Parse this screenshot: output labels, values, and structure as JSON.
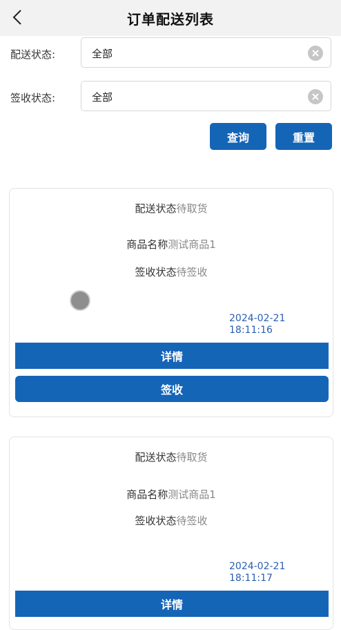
{
  "header": {
    "title": "订单配送列表"
  },
  "filters": [
    {
      "label": "配送状态:",
      "value": "全部"
    },
    {
      "label": "签收状态:",
      "value": "全部"
    }
  ],
  "actions": {
    "query_label": "查询",
    "reset_label": "重置"
  },
  "orders": [
    {
      "delivery_status_label": "配送状态",
      "delivery_status": "待取货",
      "product_label": "商品名称",
      "product_name": "测试商品1",
      "sign_status_label": "签收状态",
      "sign_status": "待签收",
      "date": "2024-02-21",
      "time": "18:11:16",
      "detail_label": "详情",
      "sign_label": "签收"
    },
    {
      "delivery_status_label": "配送状态",
      "delivery_status": "待取货",
      "product_label": "商品名称",
      "product_name": "测试商品1",
      "sign_status_label": "签收状态",
      "sign_status": "待签收",
      "date": "2024-02-21",
      "time": "18:11:17",
      "detail_label": "详情"
    }
  ],
  "colors": {
    "primary": "#1565b7",
    "timestamp": "#2a5db0",
    "value_gray": "#888888"
  },
  "icons": {
    "back": "chevron-left-icon",
    "clear": "clear-circle-icon"
  }
}
